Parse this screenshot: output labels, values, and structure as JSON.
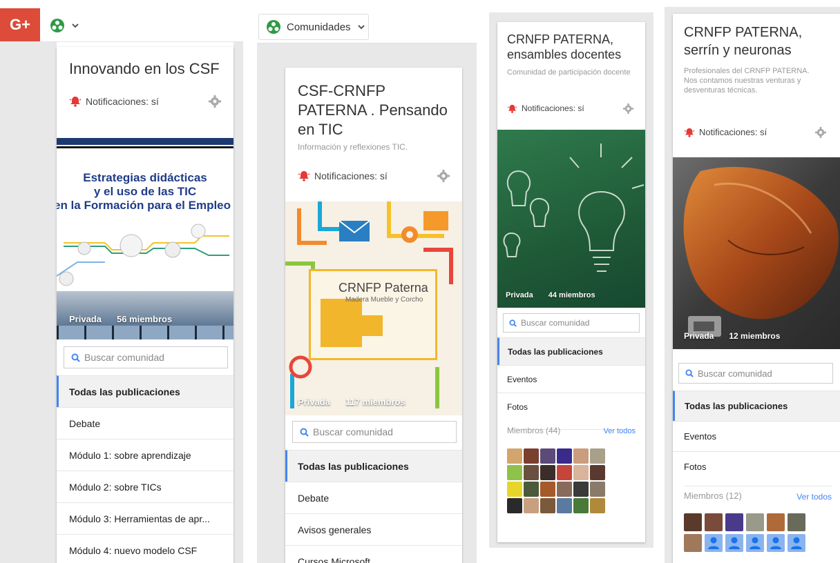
{
  "gplus_logo": "G+",
  "topbar": {
    "communities_label": "Comunidades"
  },
  "colors": {
    "gplus_red": "#dd4b39",
    "accent_blue": "#4285f4",
    "bell_red": "#e53935",
    "green_icon": "#2e9b46"
  },
  "icons": [
    "communities-icon",
    "chevron-down-icon",
    "bell-icon",
    "gear-icon",
    "search-icon",
    "person-icon"
  ],
  "panels": [
    {
      "title": "Innovando en los CSF",
      "notifications": "Notificaciones: sí",
      "hero_text": {
        "line1": "Estrategias didácticas",
        "line2": "y el uso de las TIC",
        "line3": "en la Formación para el Empleo"
      },
      "privacy": "Privada",
      "members_count": "56 miembros",
      "search_placeholder": "Buscar comunidad",
      "menu": [
        "Todas las publicaciones",
        "Debate",
        "Módulo 1: sobre aprendizaje",
        "Módulo 2: sobre TICs",
        "Módulo 3: Herramientas de apr...",
        "Módulo 4: nuevo modelo CSF"
      ]
    },
    {
      "title": "CSF-CRNFP PATERNA . Pensando en TIC",
      "description": "Información y reflexiones TIC.",
      "notifications": "Notificaciones: sí",
      "hero_text": {
        "logo_title": "CRNFP Paterna",
        "logo_sub": "Madera Mueble y Corcho"
      },
      "privacy": "Privada",
      "members_count": "117 miembros",
      "search_placeholder": "Buscar comunidad",
      "menu": [
        "Todas las publicaciones",
        "Debate",
        "Avisos generales",
        "Cursos Microsoft"
      ]
    },
    {
      "title": "CRNFP PATERNA, ensambles docentes",
      "description": "Comunidad de participación docente",
      "notifications": "Notificaciones: sí",
      "privacy": "Privada",
      "members_count": "44 miembros",
      "search_placeholder": "Buscar comunidad",
      "menu": [
        "Todas las publicaciones",
        "Eventos",
        "Fotos"
      ],
      "members_header": "Miembros (44)",
      "see_all": "Ver todos"
    },
    {
      "title": "CRNFP PATERNA, serrín y neuronas",
      "description": "Profesionales del CRNFP PATERNA. Nos contamos nuestras venturas y desventuras técnicas.",
      "notifications": "Notificaciones: sí",
      "privacy": "Privada",
      "members_count": "12 miembros",
      "search_placeholder": "Buscar comunidad",
      "menu": [
        "Todas las publicaciones",
        "Eventos",
        "Fotos"
      ],
      "members_header": "Miembros (12)",
      "see_all": "Ver todos"
    }
  ]
}
